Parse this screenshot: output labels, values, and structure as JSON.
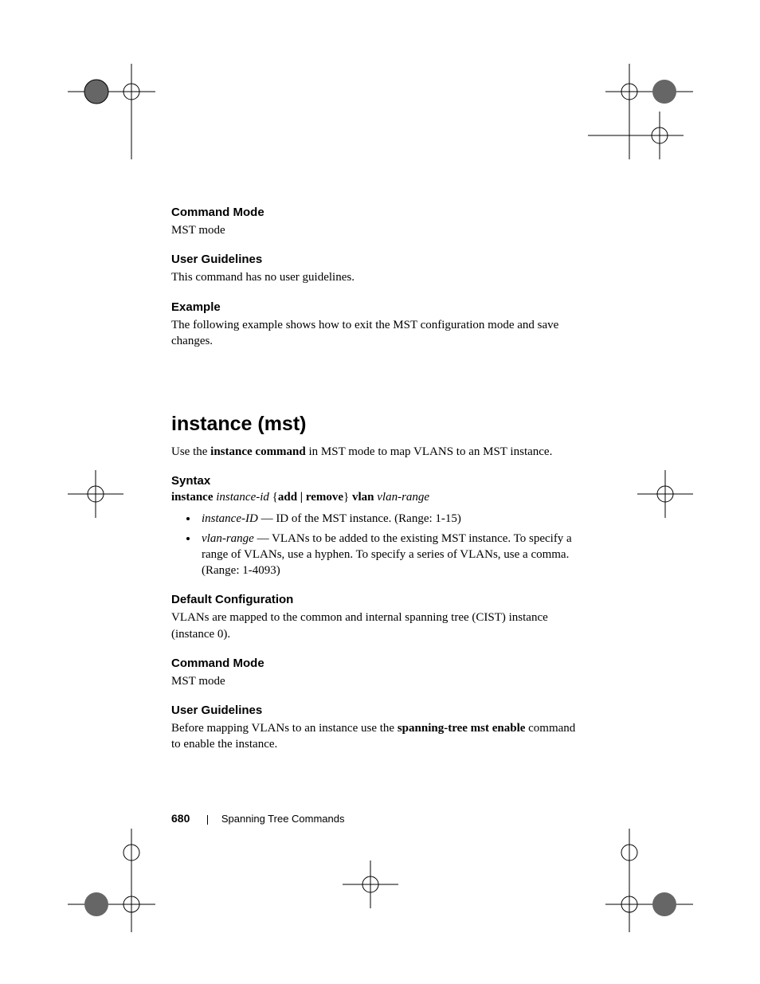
{
  "sections": {
    "cmd_mode_1": {
      "head": "Command Mode",
      "body": "MST mode"
    },
    "user_guide_1": {
      "head": "User Guidelines",
      "body": "This command has no user guidelines."
    },
    "example": {
      "head": "Example",
      "body": "The following example shows how to exit the MST configuration mode and save changes."
    }
  },
  "main_heading": "instance (mst)",
  "main_intro_pre": "Use the ",
  "main_intro_bold": "instance command",
  "main_intro_post": " in MST mode to map VLANS to an MST instance.",
  "syntax": {
    "head": "Syntax",
    "kw1": "instance",
    "arg1": "instance-id",
    "mid": " {",
    "kw2": "add | remove",
    "mid2": "} ",
    "kw3": "vlan",
    "arg2": "vlan-range"
  },
  "params": [
    {
      "term": "instance-ID",
      "desc": " — ID of the MST instance. (Range: 1-15)"
    },
    {
      "term": "vlan-range",
      "desc": " — VLANs to be added to the existing MST instance. To specify a range of VLANs, use a hyphen. To specify a series of VLANs, use a comma. (Range: 1-4093)"
    }
  ],
  "default_cfg": {
    "head": "Default Configuration",
    "body": "VLANs are mapped to the common and internal spanning tree (CIST) instance (instance 0)."
  },
  "cmd_mode_2": {
    "head": "Command Mode",
    "body": "MST mode"
  },
  "user_guide_2": {
    "head": "User Guidelines",
    "pre": "Before mapping VLANs to an instance use the ",
    "bold": "spanning-tree mst enable",
    "post": " command to enable the instance."
  },
  "footer": {
    "page": "680",
    "chapter": "Spanning Tree Commands"
  }
}
